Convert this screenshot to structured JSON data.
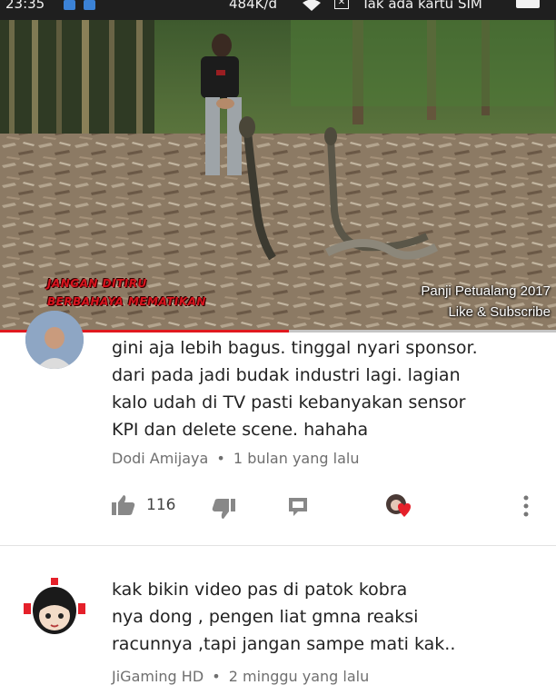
{
  "status_bar": {
    "time": "23:35",
    "network_speed": "484K/d",
    "carrier_text": "Tak ada kartu SIM",
    "icons": [
      "shield-notification-icon",
      "notification-icon",
      "wifi-icon",
      "no-sim-icon",
      "battery-icon"
    ]
  },
  "video": {
    "overlay_left_line1": "JANGAN DITIRU",
    "overlay_left_line2": "BERBAHAYA MEMATIKAN",
    "watermark_line1": "Panji Petualang 2017",
    "watermark_line2": "Like & Subscribe",
    "progress_fraction": 0.52,
    "progress_color": "#e0191f"
  },
  "comments": [
    {
      "text_lines": [
        "gini aja lebih bagus. tinggal nyari sponsor.",
        "dari pada jadi budak industri lagi. lagian",
        "kalo udah di TV pasti kebanyakan sensor",
        "KPI dan delete scene. hahaha"
      ],
      "author": "Dodi Amijaya",
      "separator": "•",
      "time": "1 bulan yang lalu",
      "like_count": "116",
      "heart_color": "#e5202a"
    },
    {
      "text_lines": [
        "kak bikin video pas di patok kobra",
        "nya dong , pengen liat gmna reaksi",
        "racunnya ,tapi jangan sampe mati kak.."
      ],
      "author": "JiGaming HD",
      "separator": "•",
      "time": "2 minggu yang lalu"
    }
  ]
}
